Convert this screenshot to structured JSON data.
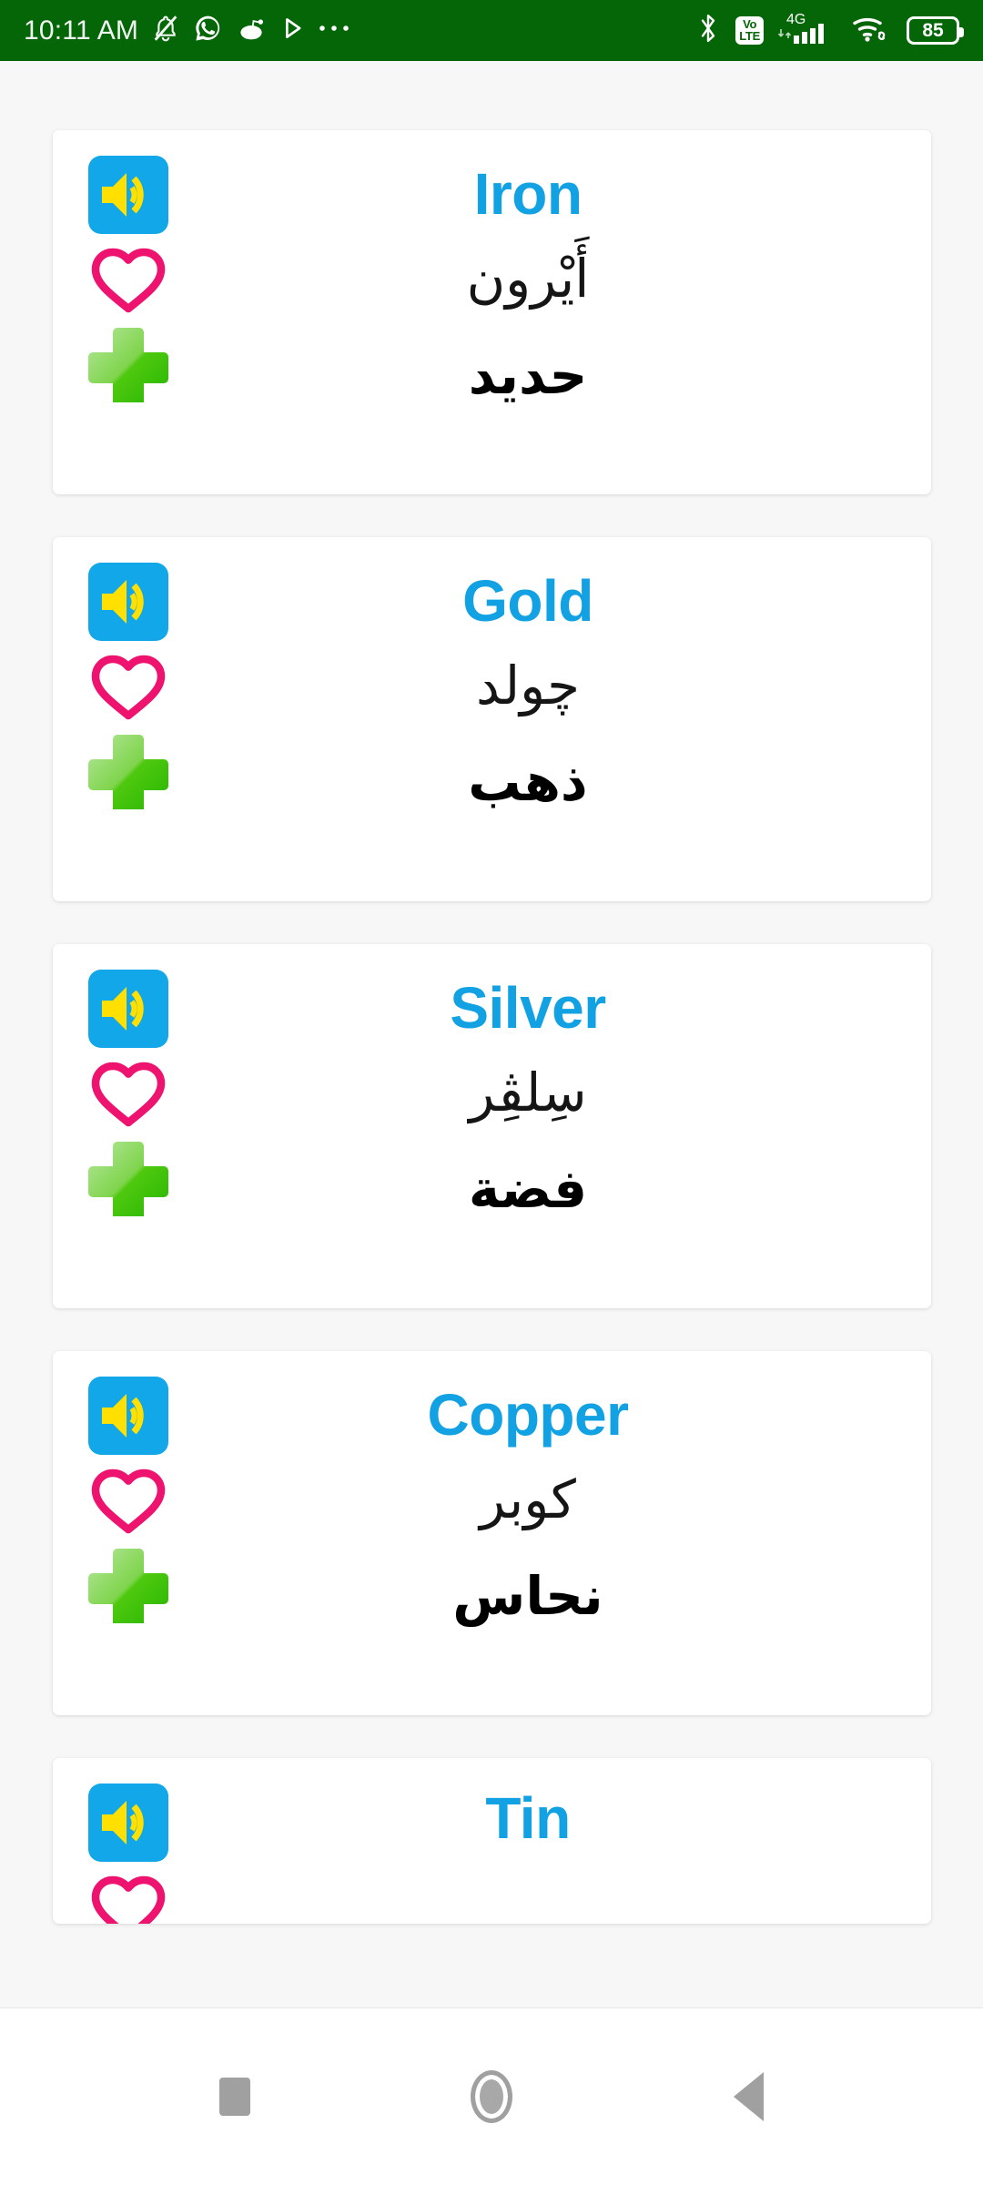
{
  "status_bar": {
    "time": "10:11 AM",
    "bg_color": "#056608",
    "left_icons": [
      "bell-muted-icon",
      "whatsapp-icon",
      "reddit-icon",
      "play-icon",
      "more-dots-icon"
    ],
    "right_icons": [
      "bluetooth-icon",
      "volte-icon",
      "signal-4g-icon",
      "wifi-icon",
      "battery-icon"
    ],
    "network_label": "4G",
    "volte_label_top": "Vo",
    "volte_label_bottom": "LTE",
    "battery_level": "85"
  },
  "theme": {
    "page_background": "#f7f7f7",
    "card_background": "#ffffff",
    "english_word_color": "#12a1e3",
    "arabic_word_color": "#000000",
    "speaker_button_color": "#11a7e8",
    "speaker_glyph_color": "#ffe000",
    "heart_color": "#ed136f",
    "plus_color": "#3ec40d"
  },
  "list": {
    "items": [
      {
        "english": "Iron",
        "transliteration": "أَيْرون",
        "arabic": "حديد",
        "speak_label": "speaker",
        "favorite_label": "favorite",
        "add_label": "add",
        "clipped": false
      },
      {
        "english": "Gold",
        "transliteration": "چولد",
        "arabic": "ذهب",
        "speak_label": "speaker",
        "favorite_label": "favorite",
        "add_label": "add",
        "clipped": false
      },
      {
        "english": "Silver",
        "transliteration": "سِلڤِر",
        "arabic": "فضة",
        "speak_label": "speaker",
        "favorite_label": "favorite",
        "add_label": "add",
        "clipped": false
      },
      {
        "english": "Copper",
        "transliteration": "كوبر",
        "arabic": "نحاس",
        "speak_label": "speaker",
        "favorite_label": "favorite",
        "add_label": "add",
        "clipped": false
      },
      {
        "english": "Tin",
        "transliteration": "",
        "arabic": "",
        "speak_label": "speaker",
        "favorite_label": "favorite",
        "add_label": "add",
        "clipped": true
      }
    ]
  },
  "nav_bar": {
    "recents_label": "Recents",
    "home_label": "Home",
    "back_label": "Back"
  }
}
